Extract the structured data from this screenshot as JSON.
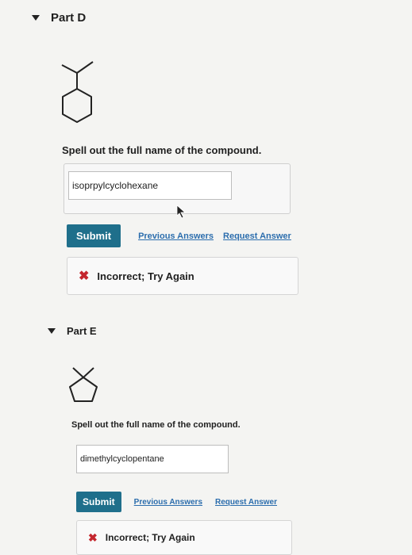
{
  "part_d": {
    "title": "Part D",
    "prompt": "Spell out the full name of the compound.",
    "answer_value": "isoprpylcyclohexane",
    "submit_label": "Submit",
    "previous_answers_label": "Previous Answers",
    "request_answer_label": "Request Answer",
    "feedback": "Incorrect; Try Again",
    "feedback_icon": "x-icon"
  },
  "part_e": {
    "title": "Part E",
    "prompt": "Spell out the full name of the compound.",
    "answer_value": "dimethylcyclopentane",
    "submit_label": "Submit",
    "previous_answers_label": "Previous Answers",
    "request_answer_label": "Request Answer",
    "feedback": "Incorrect; Try Again",
    "feedback_icon": "x-icon"
  },
  "colors": {
    "submit_bg": "#1f6f8b",
    "link": "#2b6dad",
    "error": "#c4262e"
  }
}
